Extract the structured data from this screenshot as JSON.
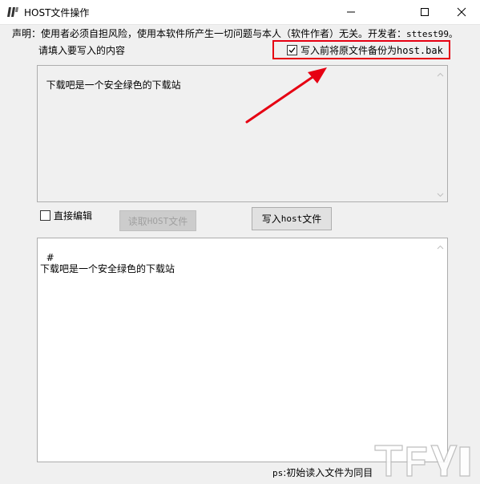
{
  "window": {
    "title": "HOST文件操作"
  },
  "disclaimer": {
    "text": "声明：使用者必须自担风险，使用本软件所产生一切问题与本人（软件作者）无关。开发者：",
    "developer": "sttest99。"
  },
  "top_section": {
    "label": "请填入要写入的内容",
    "backup_checkbox": {
      "checked": true,
      "label_cn": "写入前将原文件备份为",
      "label_file": "host.bak"
    },
    "textarea_value": "下载吧是一个安全绿色的下载站"
  },
  "controls": {
    "direct_edit": {
      "checked": false,
      "label": "直接编辑"
    },
    "read_button": {
      "label_cn": "读取",
      "label_en": "HOST",
      "label_tail": "文件",
      "disabled": true
    },
    "write_button": {
      "label_cn": "写入",
      "label_en": "host",
      "label_tail": "文件"
    }
  },
  "bottom_section": {
    "textarea_value": "#\n下载吧是一个安全绿色的下载站"
  },
  "footer": {
    "note_prefix": "ps",
    "note_text": ":初始读入文件为同目"
  },
  "colors": {
    "highlight": "#e60012",
    "arrow": "#e60012"
  },
  "icons": [
    "app-icon",
    "minimize-icon",
    "maximize-icon",
    "close-icon",
    "checkmark-icon",
    "scroll-up-icon",
    "scroll-down-icon",
    "red-arrow-icon",
    "watermark-logo"
  ]
}
